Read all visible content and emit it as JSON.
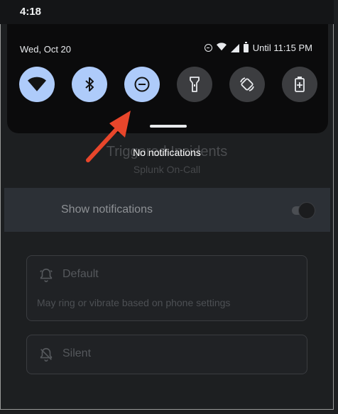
{
  "status_bar": {
    "time": "4:18"
  },
  "shade": {
    "date": "Wed, Oct 20",
    "dnd_status": "Until 11:15 PM",
    "tiles": [
      {
        "icon": "wifi-icon",
        "state": "on"
      },
      {
        "icon": "bluetooth-icon",
        "state": "on"
      },
      {
        "icon": "do-not-disturb-icon",
        "state": "on"
      },
      {
        "icon": "flashlight-icon",
        "state": "off"
      },
      {
        "icon": "auto-rotate-icon",
        "state": "off"
      },
      {
        "icon": "battery-saver-icon",
        "state": "off"
      }
    ]
  },
  "notifications": {
    "empty_text": "No notifications"
  },
  "background_app": {
    "title": "Triggered Incidents",
    "subtitle": "Splunk On-Call",
    "show_notifications_label": "Show notifications",
    "default_option": {
      "title": "Default",
      "description": "May ring or vibrate based on phone settings"
    },
    "silent_option": {
      "title": "Silent"
    }
  },
  "colors": {
    "tile_on": "#aecbfa",
    "tile_off": "#3c3d40",
    "arrow": "#e8462b"
  }
}
